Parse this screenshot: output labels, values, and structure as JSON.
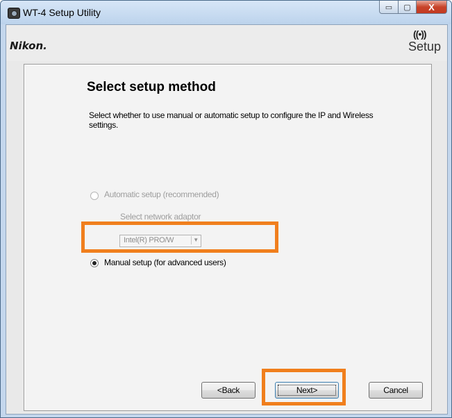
{
  "window": {
    "title": "WT-4 Setup Utility",
    "icon": "camera-icon"
  },
  "title_buttons": {
    "minimize": "▭",
    "maximize": "▢",
    "close": "X"
  },
  "header": {
    "brand": "Nikon.",
    "logo_waves": "((•))",
    "logo_label": "Setup"
  },
  "panel": {
    "title": "Select setup method",
    "description": "Select whether to use manual or automatic setup to configure the IP and Wireless settings.",
    "options": [
      {
        "label": "Automatic setup (recommended)",
        "selected": false,
        "enabled": false
      },
      {
        "label": "Manual setup (for advanced users)",
        "selected": true,
        "enabled": true
      }
    ],
    "adapter_label": "Select network adaptor",
    "adapter_value": "Intel(R) PRO/W"
  },
  "buttons": {
    "back": "<Back",
    "next": "Next>",
    "cancel": "Cancel"
  },
  "colors": {
    "highlight": "#f07f1d",
    "window_frame": "#b9cfe8"
  }
}
